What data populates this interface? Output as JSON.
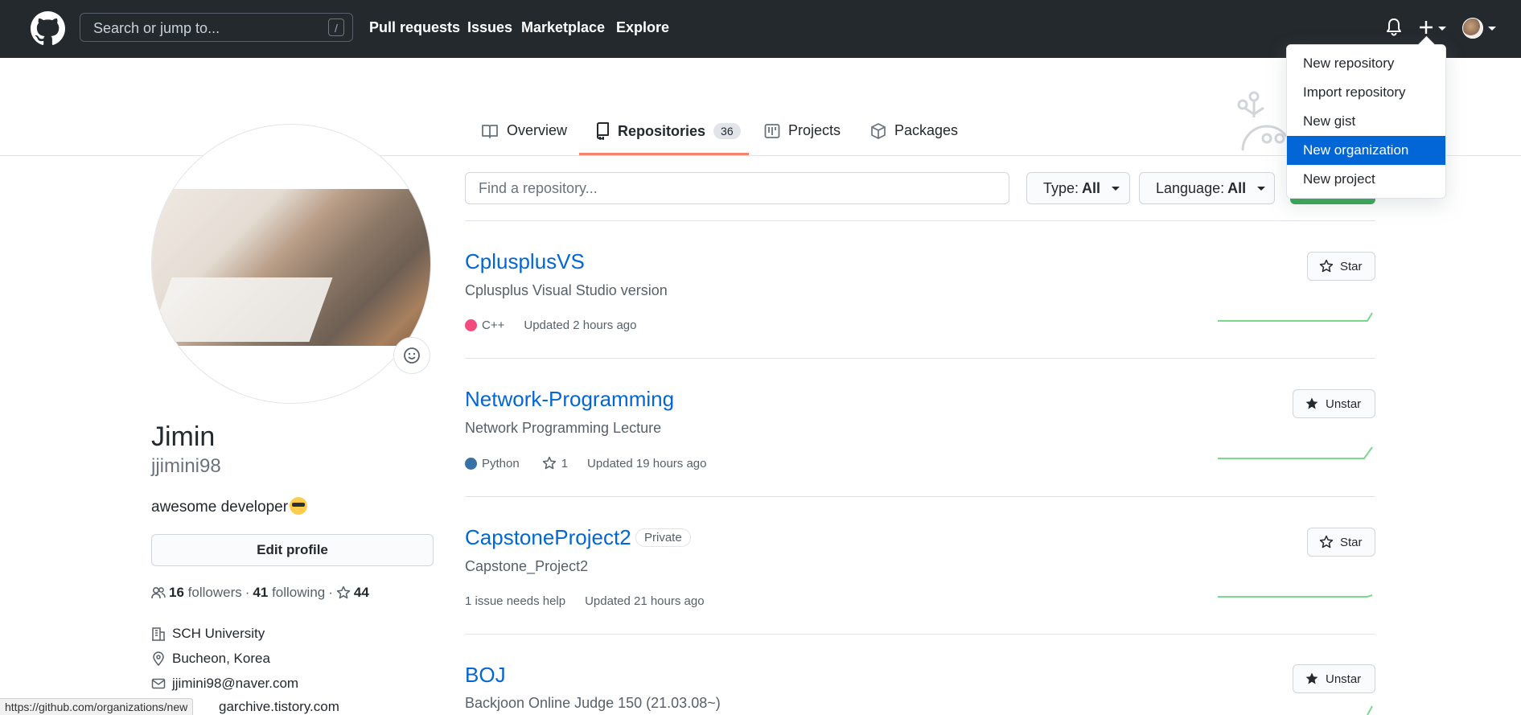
{
  "header": {
    "search_placeholder": "Search or jump to...",
    "search_shortcut": "/",
    "nav": [
      "Pull requests",
      "Issues",
      "Marketplace",
      "Explore"
    ]
  },
  "tabs": {
    "overview": "Overview",
    "repositories": "Repositories",
    "repositories_count": "36",
    "projects": "Projects",
    "packages": "Packages"
  },
  "profile": {
    "name": "Jimin",
    "login": "jjimini98",
    "bio": "awesome developer",
    "edit_button": "Edit profile",
    "followers_count": "16",
    "followers_label": "followers",
    "following_count": "41",
    "following_label": "following",
    "stars_count": "44",
    "company": "SCH University",
    "location": "Bucheon, Korea",
    "email": "jjimini98@naver.com",
    "website": "garchive.tistory.com"
  },
  "repo_filter": {
    "find_placeholder": "Find a repository...",
    "type_label": "Type:",
    "type_value": "All",
    "language_label": "Language:",
    "language_value": "All"
  },
  "repos": [
    {
      "name": "CplusplusVS",
      "description": "Cplusplus Visual Studio version",
      "language": "C++",
      "language_color": "#f34b7d",
      "updated": "Updated 2 hours ago",
      "star_button": "Star"
    },
    {
      "name": "Network-Programming",
      "description": "Network Programming Lecture",
      "language": "Python",
      "language_color": "#3572A5",
      "stars": "1",
      "updated": "Updated 19 hours ago",
      "star_button": "Unstar"
    },
    {
      "name": "CapstoneProject2",
      "badge": "Private",
      "description": "Capstone_Project2",
      "issues": "1 issue needs help",
      "updated": "Updated 21 hours ago",
      "star_button": "Star"
    },
    {
      "name": "BOJ",
      "description": "Backjoon Online Judge 150 (21.03.08~)",
      "star_button": "Unstar"
    }
  ],
  "create_menu": {
    "items": [
      "New repository",
      "Import repository",
      "New gist",
      "New organization",
      "New project"
    ],
    "highlighted": "New organization"
  },
  "status_url": "https://github.com/organizations/new",
  "colors": {
    "header_bg": "#24292e",
    "link": "#0366d6",
    "tab_underline": "#f9826c",
    "menu_highlight": "#0366d6",
    "new_button": "#2ea44f",
    "sparkline": "#7bd88f"
  }
}
